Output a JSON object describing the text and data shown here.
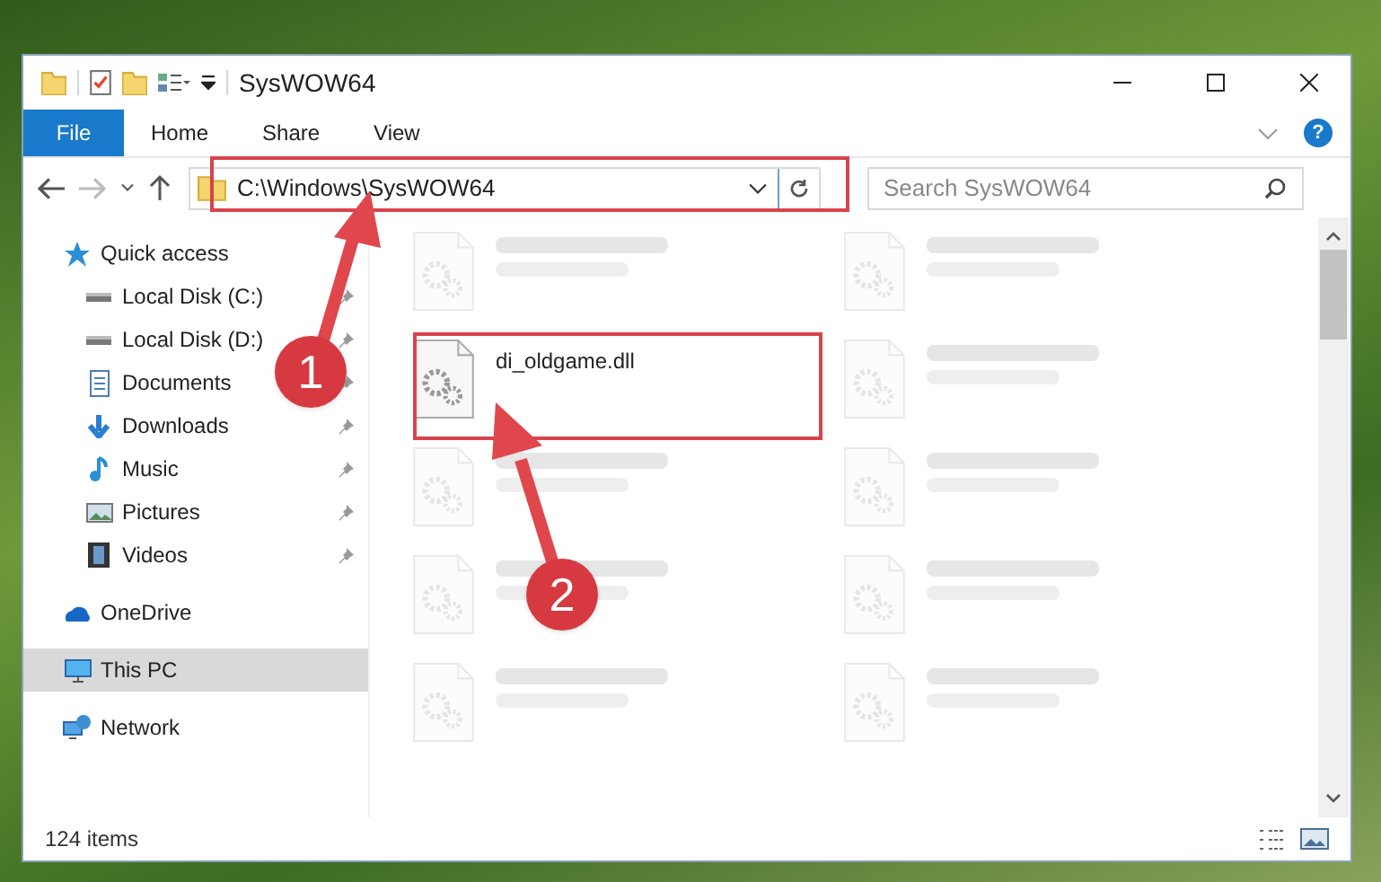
{
  "window": {
    "title": "SysWOW64"
  },
  "ribbon_tabs": [
    {
      "label": "File",
      "kind": "file"
    },
    {
      "label": "Home",
      "kind": "tab"
    },
    {
      "label": "Share",
      "kind": "tab"
    },
    {
      "label": "View",
      "kind": "tab"
    }
  ],
  "help_button": {
    "label": "?"
  },
  "address_bar": {
    "path": "C:\\Windows\\SysWOW64"
  },
  "search": {
    "placeholder": "Search SysWOW64"
  },
  "navigation": [
    {
      "label": "Quick access",
      "kind": "star",
      "selected": false,
      "children": [
        {
          "label": "Local Disk (C:)",
          "kind": "drive",
          "pinned": true
        },
        {
          "label": "Local Disk (D:)",
          "kind": "drive",
          "pinned": true
        },
        {
          "label": "Documents",
          "kind": "document",
          "pinned": true
        },
        {
          "label": "Downloads",
          "kind": "download",
          "pinned": true
        },
        {
          "label": "Music",
          "kind": "music",
          "pinned": true
        },
        {
          "label": "Pictures",
          "kind": "picture",
          "pinned": true
        },
        {
          "label": "Videos",
          "kind": "video",
          "pinned": true
        }
      ]
    },
    {
      "label": "OneDrive",
      "kind": "cloud",
      "selected": false
    },
    {
      "label": "This PC",
      "kind": "pc",
      "selected": true
    },
    {
      "label": "Network",
      "kind": "network",
      "selected": false
    }
  ],
  "files": [
    {
      "dimmed": true
    },
    {
      "dimmed": true
    },
    {
      "name": "di_oldgame.dll",
      "dimmed": false
    },
    {
      "dimmed": true
    },
    {
      "dimmed": true
    },
    {
      "dimmed": true
    },
    {
      "dimmed": true
    },
    {
      "dimmed": true
    },
    {
      "dimmed": true
    },
    {
      "dimmed": true
    }
  ],
  "status_bar": {
    "item_count": "124 items"
  },
  "annotations": [
    {
      "number": "1"
    },
    {
      "number": "2"
    }
  ]
}
